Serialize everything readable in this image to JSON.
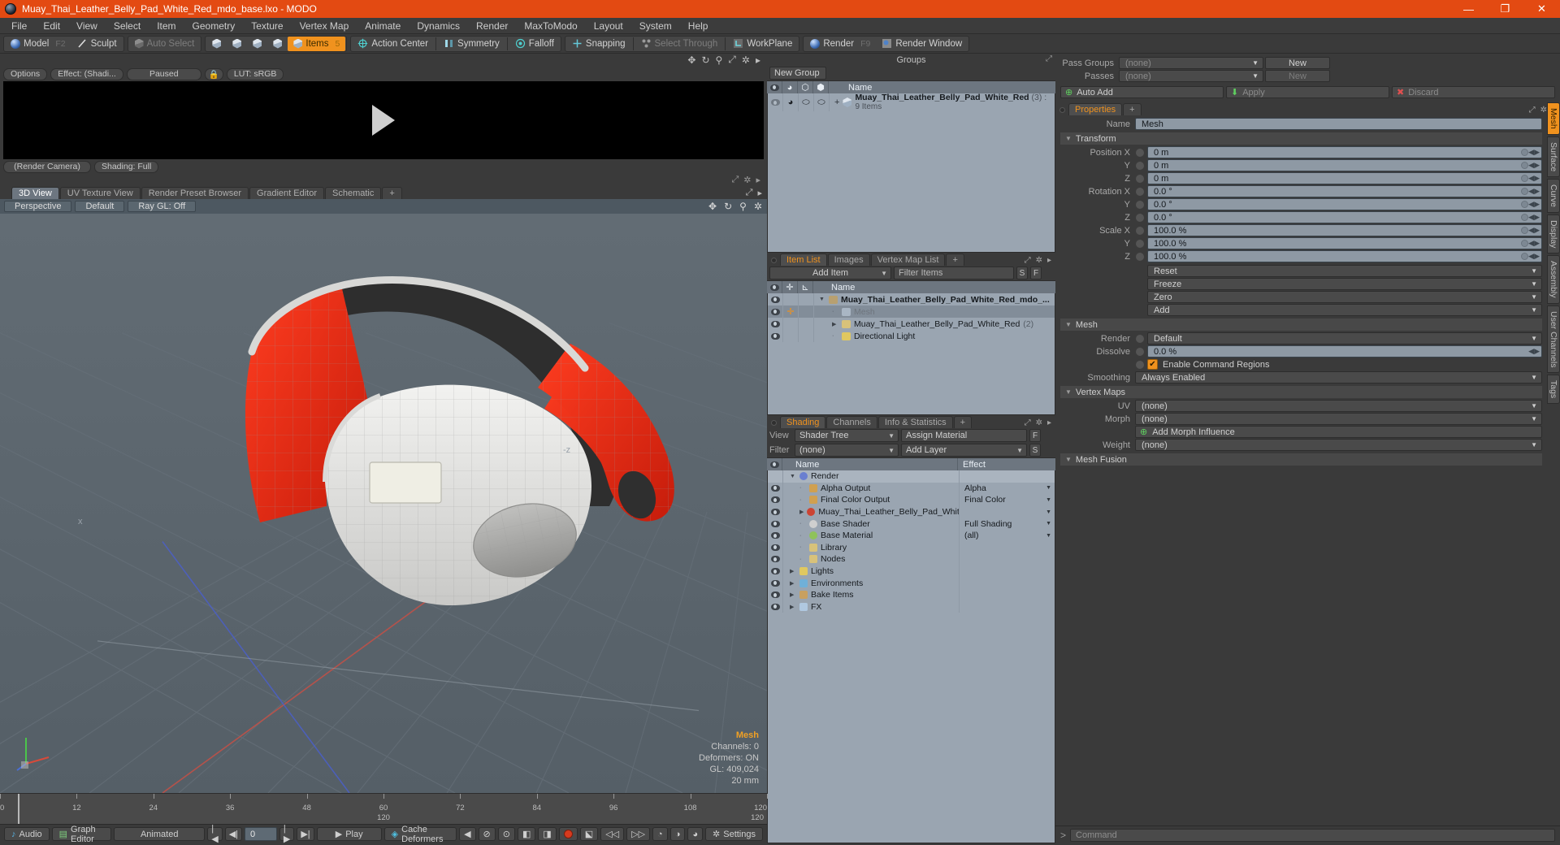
{
  "window": {
    "title": "Muay_Thai_Leather_Belly_Pad_White_Red_mdo_base.lxo - MODO",
    "minimize": "—",
    "maximize": "❐",
    "close": "✕"
  },
  "menubar": {
    "items": [
      "File",
      "Edit",
      "View",
      "Select",
      "Item",
      "Geometry",
      "Texture",
      "Vertex Map",
      "Animate",
      "Dynamics",
      "Render",
      "MaxToModo",
      "Layout",
      "System",
      "Help"
    ]
  },
  "modebar": {
    "model": "Model",
    "model_key": "F2",
    "sculpt": "Sculpt",
    "auto_select": "Auto Select",
    "items": "Items",
    "items_key": "5",
    "action_center": "Action Center",
    "symmetry": "Symmetry",
    "falloff": "Falloff",
    "snapping": "Snapping",
    "select_through": "Select Through",
    "workplane": "WorkPlane",
    "render": "Render",
    "render_key": "F9",
    "render_window": "Render Window"
  },
  "preview": {
    "options": "Options",
    "effect": "Effect: (Shadi...",
    "paused": "Paused",
    "lut": "LUT: sRGB",
    "render_camera": "(Render Camera)",
    "shading": "Shading: Full"
  },
  "viewport": {
    "tabs": [
      {
        "label": "3D View",
        "selected": true
      },
      {
        "label": "UV Texture View",
        "selected": false
      },
      {
        "label": "Render Preset Browser",
        "selected": false
      },
      {
        "label": "Gradient Editor",
        "selected": false
      },
      {
        "label": "Schematic",
        "selected": false
      },
      {
        "label": "+",
        "selected": false
      }
    ],
    "bar": [
      "Perspective",
      "Default",
      "Ray GL: Off"
    ],
    "stats": {
      "title": "Mesh",
      "channels": "Channels: 0",
      "deformers": "Deformers: ON",
      "gl": "GL: 409,024",
      "scale": "20 mm"
    },
    "axis_z": "-z"
  },
  "timeline": {
    "ticks": [
      "0",
      "12",
      "24",
      "36",
      "48",
      "60",
      "72",
      "84",
      "96",
      "108",
      "120"
    ],
    "center_label": "120",
    "right_label": "120"
  },
  "bottombar": {
    "audio": "Audio",
    "graph_editor": "Graph Editor",
    "animated": "Animated",
    "frame_value": "0",
    "play": "Play",
    "cache_deformers": "Cache Deformers",
    "settings": "Settings"
  },
  "groups": {
    "title": "Groups",
    "new_group": "New Group",
    "columns": [
      "Name"
    ],
    "rows": [
      {
        "name": "Muay_Thai_Leather_Belly_Pad_White_Red",
        "count": "(3) :",
        "sub": "9 Items"
      }
    ]
  },
  "item_list": {
    "tabs": [
      {
        "label": "Item List",
        "selected": true
      },
      {
        "label": "Images",
        "selected": false
      },
      {
        "label": "Vertex Map List",
        "selected": false
      },
      {
        "label": "+",
        "selected": false
      }
    ],
    "add_item": "Add Item",
    "filter_placeholder": "Filter Items",
    "btn_s": "S",
    "btn_f": "F",
    "columns": [
      "Name"
    ],
    "rows": [
      {
        "name": "Muay_Thai_Leather_Belly_Pad_White_Red_mdo_...",
        "indent": 0,
        "icon": "scene-icon",
        "bold": true,
        "suffix": ""
      },
      {
        "name": "Mesh",
        "indent": 1,
        "icon": "mesh-icon",
        "bold": false,
        "suffix": "",
        "selected": true,
        "dim": true
      },
      {
        "name": "Muay_Thai_Leather_Belly_Pad_White_Red",
        "indent": 1,
        "icon": "folder-icon",
        "bold": false,
        "suffix": "(2)"
      },
      {
        "name": "Directional Light",
        "indent": 1,
        "icon": "light-icon",
        "bold": false,
        "suffix": ""
      }
    ]
  },
  "shading": {
    "tabs": [
      {
        "label": "Shading",
        "selected": true
      },
      {
        "label": "Channels",
        "selected": false
      },
      {
        "label": "Info & Statistics",
        "selected": false
      },
      {
        "label": "+",
        "selected": false
      }
    ],
    "view_label": "View",
    "view_value": "Shader Tree",
    "assign_material": "Assign Material",
    "assign_f": "F",
    "filter_label": "Filter",
    "filter_value": "(none)",
    "add_layer": "Add Layer",
    "add_layer_s": "S",
    "columns": [
      "Name",
      "Effect"
    ],
    "rows": [
      {
        "name": "Render",
        "effect": "",
        "indent": 0,
        "icon": "render-globe-icon",
        "header": true
      },
      {
        "name": "Alpha Output",
        "effect": "Alpha",
        "indent": 1,
        "icon": "output-icon",
        "dropdown": true
      },
      {
        "name": "Final Color Output",
        "effect": "Final Color",
        "indent": 1,
        "icon": "output-icon",
        "dropdown": true
      },
      {
        "name": "Muay_Thai_Leather_Belly_Pad_White_...",
        "effect": "",
        "indent": 1,
        "icon": "material-group-icon",
        "dropdown": true
      },
      {
        "name": "Base Shader",
        "effect": "Full Shading",
        "indent": 1,
        "icon": "shader-icon",
        "dropdown": true
      },
      {
        "name": "Base Material",
        "effect": "(all)",
        "indent": 1,
        "icon": "material-icon",
        "dropdown": true
      },
      {
        "name": "Library",
        "effect": "",
        "indent": 1,
        "icon": "library-icon"
      },
      {
        "name": "Nodes",
        "effect": "",
        "indent": 1,
        "icon": "nodes-icon"
      },
      {
        "name": "Lights",
        "effect": "",
        "indent": 0,
        "icon": "lights-icon"
      },
      {
        "name": "Environments",
        "effect": "",
        "indent": 0,
        "icon": "environments-icon"
      },
      {
        "name": "Bake Items",
        "effect": "",
        "indent": 0,
        "icon": "bake-icon"
      },
      {
        "name": "FX",
        "effect": "",
        "indent": 0,
        "icon": "fx-icon"
      }
    ]
  },
  "passes": {
    "pass_groups_label": "Pass Groups",
    "pass_groups_value": "(none)",
    "pass_groups_new": "New",
    "passes_label": "Passes",
    "passes_value": "(none)",
    "passes_new": "New",
    "auto_add": "Auto Add",
    "apply": "Apply",
    "discard": "Discard"
  },
  "properties": {
    "tabs": [
      {
        "label": "Properties",
        "selected": true
      },
      {
        "label": "+",
        "selected": false
      }
    ],
    "name_label": "Name",
    "name_value": "Mesh",
    "transform_header": "Transform",
    "transform": [
      {
        "label": "Position X",
        "value": "0 m"
      },
      {
        "label": "Y",
        "value": "0 m"
      },
      {
        "label": "Z",
        "value": "0 m"
      },
      {
        "label": "Rotation X",
        "value": "0.0 °"
      },
      {
        "label": "Y",
        "value": "0.0 °"
      },
      {
        "label": "Z",
        "value": "0.0 °"
      },
      {
        "label": "Scale X",
        "value": "100.0 %"
      },
      {
        "label": "Y",
        "value": "100.0 %"
      },
      {
        "label": "Z",
        "value": "100.0 %"
      }
    ],
    "transform_actions": [
      "Reset",
      "Freeze",
      "Zero",
      "Add"
    ],
    "mesh_header": "Mesh",
    "render_label": "Render",
    "render_value": "Default",
    "dissolve_label": "Dissolve",
    "dissolve_value": "0.0 %",
    "enable_command_regions": "Enable Command Regions",
    "smoothing_label": "Smoothing",
    "smoothing_value": "Always Enabled",
    "vertex_maps_header": "Vertex Maps",
    "vertex_maps": [
      {
        "label": "UV",
        "value": "(none)"
      },
      {
        "label": "Morph",
        "value": "(none)"
      }
    ],
    "add_morph_influence": "Add Morph Influence",
    "weight_label": "Weight",
    "weight_value": "(none)",
    "mesh_fusion_header": "Mesh Fusion",
    "vtabs": [
      {
        "label": "Mesh",
        "selected": true
      },
      {
        "label": "Surface",
        "selected": false
      },
      {
        "label": "Curve",
        "selected": false
      },
      {
        "label": "Display",
        "selected": false
      },
      {
        "label": "Assembly",
        "selected": false
      },
      {
        "label": "User Channels",
        "selected": false
      },
      {
        "label": "Tags",
        "selected": false
      }
    ]
  },
  "command": {
    "prompt": ">",
    "placeholder": "Command"
  },
  "colors": {
    "accent": "#f0921e",
    "title_bar": "#e34a12",
    "panel_bg": "#3a3a3a",
    "tree_bg": "#9aa5b1",
    "viewport_bg": "#5c666e",
    "model_red": "#e02b18",
    "model_white": "#e6e6e4"
  }
}
